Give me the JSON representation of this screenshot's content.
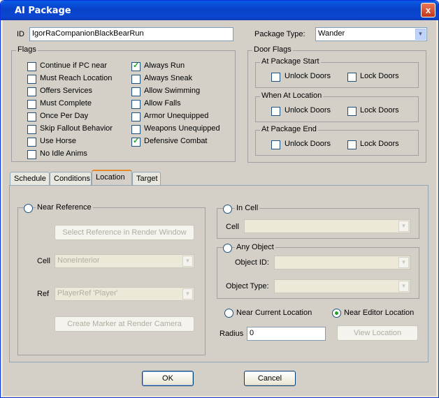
{
  "window": {
    "title": "AI Package",
    "close_glyph": "x"
  },
  "id_field": {
    "label": "ID",
    "value": "IgorRaCompanionBlackBearRun"
  },
  "package_type": {
    "label": "Package Type:",
    "value": "Wander"
  },
  "flags": {
    "title": "Flags",
    "left": [
      {
        "label": "Continue if PC near",
        "checked": false
      },
      {
        "label": "Must Reach Location",
        "checked": false
      },
      {
        "label": "Offers Services",
        "checked": false
      },
      {
        "label": "Must Complete",
        "checked": false
      },
      {
        "label": "Once Per Day",
        "checked": false
      },
      {
        "label": "Skip Fallout Behavior",
        "checked": false
      },
      {
        "label": "Use Horse",
        "checked": false
      },
      {
        "label": "No Idle Anims",
        "checked": false
      }
    ],
    "right": [
      {
        "label": "Always Run",
        "checked": true
      },
      {
        "label": "Always Sneak",
        "checked": false
      },
      {
        "label": "Allow Swimming",
        "checked": false
      },
      {
        "label": "Allow Falls",
        "checked": false
      },
      {
        "label": "Armor Unequipped",
        "checked": false
      },
      {
        "label": "Weapons Unequipped",
        "checked": false
      },
      {
        "label": "Defensive Combat",
        "checked": true
      }
    ]
  },
  "door_flags": {
    "title": "Door Flags",
    "groups": [
      {
        "title": "At Package Start",
        "unlock": "Unlock Doors",
        "lock": "Lock Doors"
      },
      {
        "title": "When At Location",
        "unlock": "Unlock Doors",
        "lock": "Lock Doors"
      },
      {
        "title": "At Package End",
        "unlock": "Unlock Doors",
        "lock": "Lock Doors"
      }
    ]
  },
  "tabs": [
    "Schedule",
    "Conditions",
    "Location",
    "Target"
  ],
  "active_tab": "Location",
  "location": {
    "near_reference": {
      "label": "Near Reference",
      "select_button": "Select Reference in Render Window",
      "cell_label": "Cell",
      "cell_value": "NoneInterior",
      "ref_label": "Ref",
      "ref_value": "PlayerRef 'Player'",
      "create_button": "Create Marker at Render Camera"
    },
    "in_cell": {
      "label": "In Cell",
      "cell_label": "Cell",
      "cell_value": ""
    },
    "any_object": {
      "label": "Any Object",
      "object_id_label": "Object ID:",
      "object_id_value": "",
      "object_type_label": "Object Type:",
      "object_type_value": ""
    },
    "near_current": "Near Current Location",
    "near_editor": "Near Editor Location",
    "radius_label": "Radius",
    "radius_value": "0",
    "view_location": "View Location"
  },
  "buttons": {
    "ok": "OK",
    "cancel": "Cancel"
  },
  "icons": {
    "checkbox_check": "check-icon",
    "dropdown_arrow": "chevron-down-icon"
  }
}
